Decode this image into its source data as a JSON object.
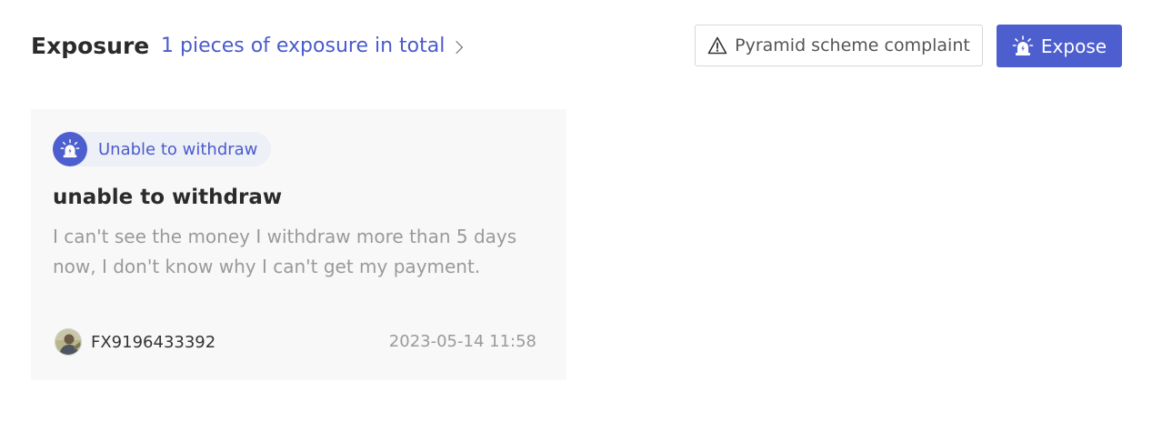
{
  "header": {
    "title": "Exposure",
    "total_link": "1 pieces of exposure in total",
    "complaint_button": "Pyramid scheme complaint",
    "expose_button": "Expose"
  },
  "card": {
    "tag_label": "Unable to withdraw",
    "title": "unable to withdraw",
    "body": "I can't see the money I withdraw more than 5 days now, I don't know why I can't get my payment.",
    "user_id": "FX9196433392",
    "timestamp": "2023-05-14 11:58"
  },
  "colors": {
    "accent": "#4d5fcf",
    "link": "#4a5bcc",
    "card_bg": "#f8f8f8",
    "muted_text": "#9a9a9a"
  },
  "icons": {
    "chevron": "chevron-right-icon",
    "warning": "warning-triangle-icon",
    "siren": "siren-icon",
    "avatar": "user-avatar"
  }
}
